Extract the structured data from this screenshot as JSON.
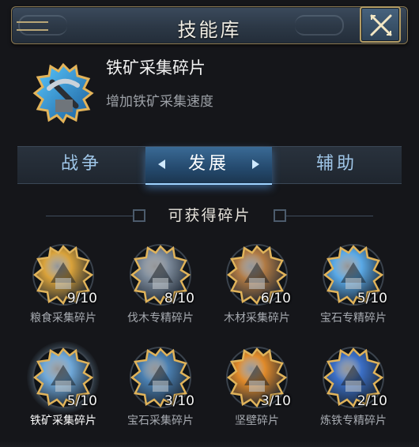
{
  "header": {
    "title": "技能库"
  },
  "selected": {
    "name": "铁矿采集碎片",
    "description": "增加铁矿采集速度"
  },
  "tabs": [
    {
      "label": "战争",
      "active": false
    },
    {
      "label": "发展",
      "active": true
    },
    {
      "label": "辅助",
      "active": false
    }
  ],
  "section": {
    "title": "可获得碎片"
  },
  "fragments": [
    {
      "count": "9/10",
      "label": "粮食采集碎片",
      "icon": "wheat-icon",
      "color": "#d9a23a"
    },
    {
      "count": "8/10",
      "label": "伐木专精碎片",
      "icon": "axe-icon",
      "color": "#7c8a9a"
    },
    {
      "count": "6/10",
      "label": "木材采集碎片",
      "icon": "log-icon",
      "color": "#b07a44"
    },
    {
      "count": "5/10",
      "label": "宝石专精碎片",
      "icon": "gem-icon",
      "color": "#5aa9e6"
    },
    {
      "count": "5/10",
      "label": "铁矿采集碎片",
      "icon": "pickaxe-icon",
      "color": "#6fa8d8",
      "selected": true
    },
    {
      "count": "3/10",
      "label": "宝石采集碎片",
      "icon": "crystal-icon",
      "color": "#4a7fb0"
    },
    {
      "count": "3/10",
      "label": "坚壁碎片",
      "icon": "wall-icon",
      "color": "#e08a2a"
    },
    {
      "count": "2/10",
      "label": "炼铁专精碎片",
      "icon": "forge-icon",
      "color": "#3b6fc6"
    }
  ]
}
